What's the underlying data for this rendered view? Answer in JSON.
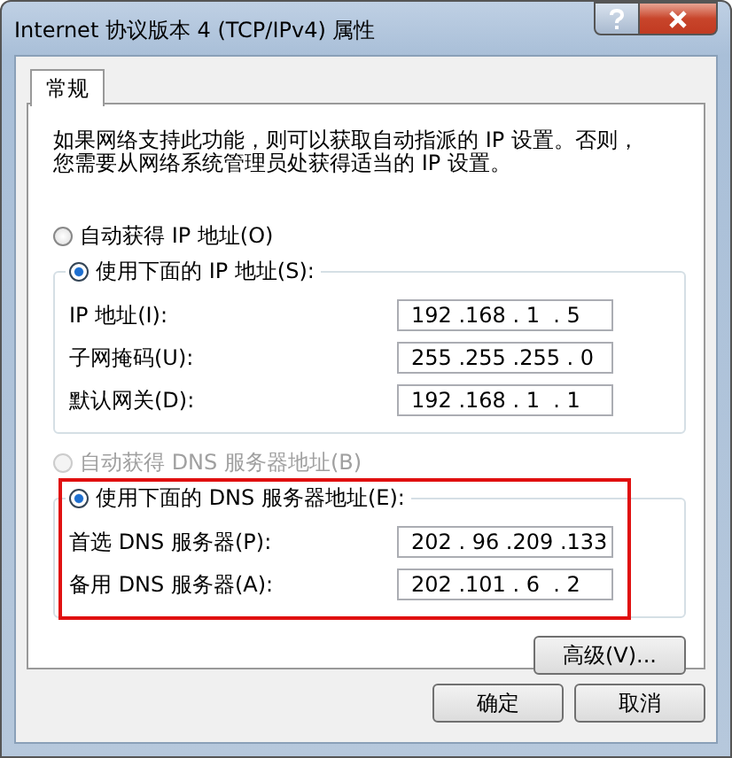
{
  "window": {
    "title": "Internet 协议版本 4 (TCP/IPv4) 属性"
  },
  "tabs": [
    {
      "label": "常规",
      "selected": true
    }
  ],
  "description": "如果网络支持此功能，则可以获取自动指派的 IP 设置。否则，您需要从网络系统管理员处获得适当的 IP 设置。",
  "ip": {
    "auto": {
      "label": "自动获得 IP 地址(O)",
      "selected": false,
      "disabled": false
    },
    "manual": {
      "label": "使用下面的 IP 地址(S):",
      "selected": true,
      "disabled": false
    },
    "fields": [
      {
        "label": "IP 地址(I):",
        "value": "192 .168 . 1  . 5"
      },
      {
        "label": "子网掩码(U):",
        "value": "255 .255 .255 . 0"
      },
      {
        "label": "默认网关(D):",
        "value": "192 .168 . 1  . 1"
      }
    ]
  },
  "dns": {
    "auto": {
      "label": "自动获得 DNS 服务器地址(B)",
      "selected": false,
      "disabled": true
    },
    "manual": {
      "label": "使用下面的 DNS 服务器地址(E):",
      "selected": true,
      "disabled": false
    },
    "highlighted": true,
    "fields": [
      {
        "label": "首选 DNS 服务器(P):",
        "value": "202 . 96 .209 .133"
      },
      {
        "label": "备用 DNS 服务器(A):",
        "value": "202 .101 . 6  . 2"
      }
    ]
  },
  "advanced_button": "高级(V)...",
  "buttons": [
    "确定",
    "取消"
  ]
}
